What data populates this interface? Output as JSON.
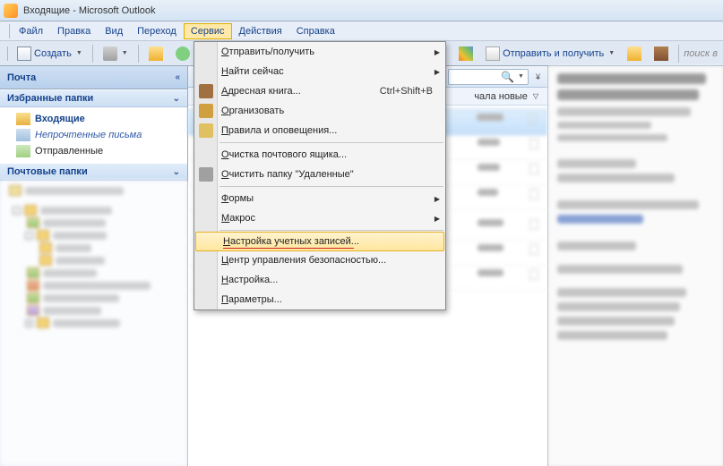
{
  "titlebar": {
    "title": "Входящие - Microsoft Outlook"
  },
  "menubar": {
    "items": [
      "Файл",
      "Правка",
      "Вид",
      "Переход",
      "Сервис",
      "Действия",
      "Справка"
    ],
    "open_index": 4
  },
  "toolbar": {
    "create": "Создать",
    "send_receive": "Отправить и получить",
    "search_placeholder": "поиск в"
  },
  "sidebar": {
    "title": "Почта",
    "fav_header": "Избранные папки",
    "fav_items": [
      {
        "label": "Входящие",
        "bold": true
      },
      {
        "label": "Непрочтенные письма",
        "italic": true
      },
      {
        "label": "Отправленные",
        "bold": false
      }
    ],
    "mail_header": "Почтовые папки"
  },
  "center": {
    "sort_label": "чала новые"
  },
  "dropdown": {
    "items": [
      {
        "label": "Отправить/получить",
        "submenu": true
      },
      {
        "label": "Найти сейчас",
        "submenu": true
      },
      {
        "label": "Адресная книга...",
        "shortcut": "Ctrl+Shift+B",
        "icon": "book"
      },
      {
        "label": "Организовать",
        "icon": "grid"
      },
      {
        "label": "Правила и оповещения...",
        "icon": "mail"
      },
      {
        "sep": true
      },
      {
        "label": "Очистка почтового ящика..."
      },
      {
        "label": "Очистить папку \"Удаленные\"",
        "icon": "trash"
      },
      {
        "sep": true
      },
      {
        "label": "Формы",
        "submenu": true
      },
      {
        "label": "Макрос",
        "submenu": true
      },
      {
        "sep": true
      },
      {
        "label": "Настройка учетных записей...",
        "highlight": true,
        "red": true
      },
      {
        "label": "Центр управления безопасностью..."
      },
      {
        "label": "Настройка..."
      },
      {
        "label": "Параметры..."
      }
    ]
  }
}
